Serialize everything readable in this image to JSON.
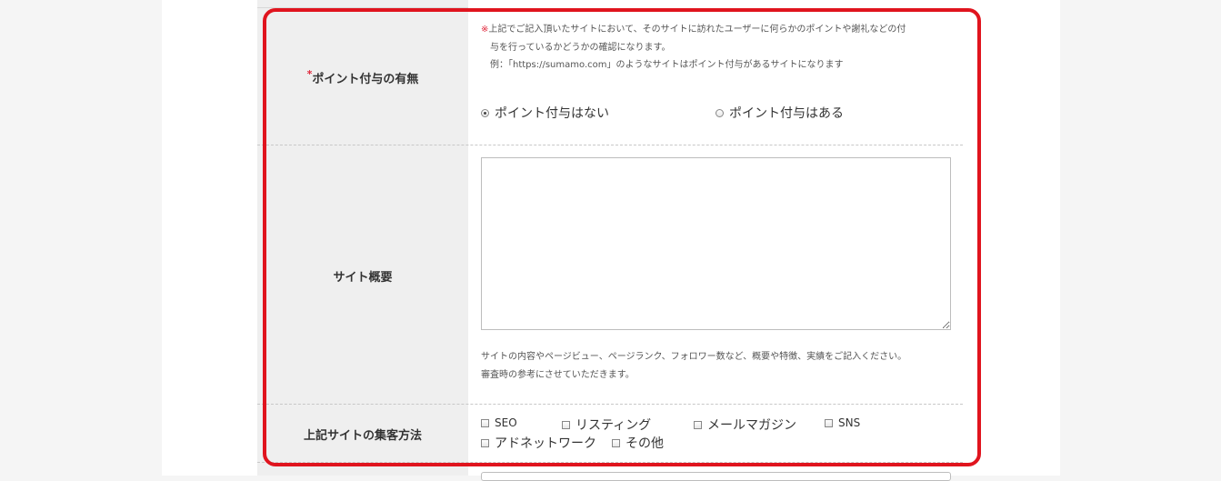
{
  "point_row": {
    "label": "ポイント付与の有無",
    "required_mark": "*",
    "note_mark": "※",
    "note_line1": "上記でご記入頂いたサイトにおいて、そのサイトに訪れたユーザーに何らかのポイントや謝礼などの付",
    "note_line2": "与を行っているかどうかの確認になります。",
    "note_line3": "例：「https://sumamo.com」のようなサイトはポイント付与があるサイトになります",
    "options": [
      {
        "label": "ポイント付与はない",
        "checked": true
      },
      {
        "label": "ポイント付与はある",
        "checked": false
      }
    ]
  },
  "overview_row": {
    "label": "サイト概要",
    "textarea_value": "",
    "hint_line1": "サイトの内容やページビュー、ページランク、フォロワー数など、概要や特徴、実績をご記入ください。",
    "hint_line2": "審査時の参考にさせていただきます。"
  },
  "method_row": {
    "label": "上記サイトの集客方法",
    "options": [
      {
        "label": "SEO",
        "checked": false
      },
      {
        "label": "リスティング",
        "checked": false
      },
      {
        "label": "メールマガジン",
        "checked": false
      },
      {
        "label": "SNS",
        "checked": false
      },
      {
        "label": "アドネットワーク",
        "checked": false
      },
      {
        "label": "その他",
        "checked": false
      }
    ]
  },
  "colors": {
    "highlight": "#e0141e",
    "required": "#e0283c",
    "label_bg": "#efefef"
  }
}
